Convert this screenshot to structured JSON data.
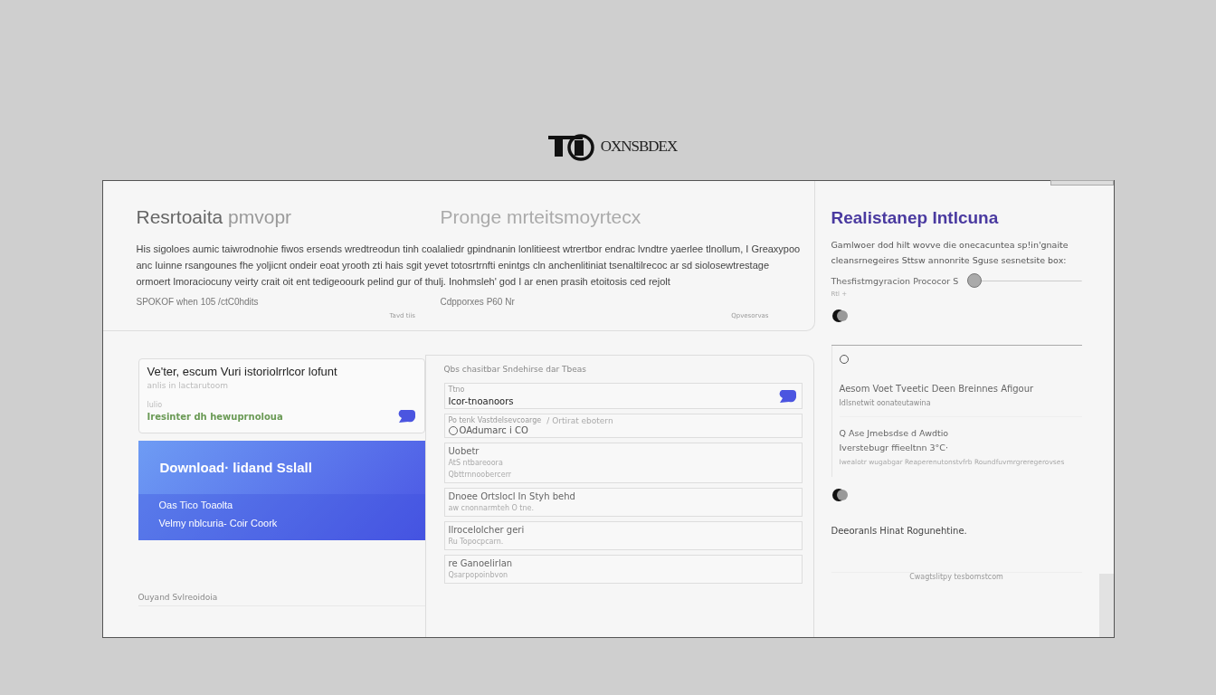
{
  "logo": {
    "text": "OXNSBDEX"
  },
  "intro": {
    "title": "Resrtoaita",
    "title_suffix": "pmvopr",
    "subtitle": "Pronge mrteitsmoyrtecx",
    "paragraph": "His sigoloes aumic taiwrodnohie fiwos ersends wredtreodun tinh coalaliedr gpindnanin lonlitieest wtrertbor endrac lvndtre yaerlee tlnollum, I Greaxypoo anc Iuinne rsangounes fhe yoljicnt ondeir eoat yrooth zti hais sgit yevet totosrtrnfti enintgs cln anchenlitiniat tsenaltilrecoc ar sd siolosewtrestage ormoert lmoraciocuny veirty crait oit ent tedigeoourk pelind gur of thulj. Inohmsleh' god I ar enen prasih etoitosis ced rejolt",
    "meta": [
      "SPOKOF when 105 /ctC0hdits",
      "Cdpporxes P60 Nr"
    ],
    "footnotes": [
      "Tavd tiis",
      "Qpvesorvas"
    ]
  },
  "feature_card": {
    "title": "Ve'ter, escum Vuri istoriolrrlcor lofunt",
    "subtitle": "anlis in lactarutoom",
    "label": "lulio",
    "status": "Iresinter dh hewuprnoloua"
  },
  "download_card": {
    "title": "Download· lidand Sslall",
    "lines": [
      "Oas Tico Toaolta",
      "Velmy nblcuria- Coir Coork"
    ]
  },
  "left_footer": "Ouyand Svlreoidoia",
  "form": {
    "heading": "Qbs chasitbar Sndehirse dar Tbeas",
    "rows": [
      {
        "kind": "field",
        "label": "Ttno",
        "value": "Icor-tnoanoors"
      },
      {
        "kind": "radio",
        "label": "Po tenk Vastdelsevcoarge",
        "note": "/ Ortirat ebotern",
        "option": "OAdumarc i CO",
        "selected": false
      },
      {
        "kind": "text",
        "lines": [
          "Uobetr",
          "AtS ntbareoora",
          "Qbttrnnoobercerr"
        ]
      },
      {
        "kind": "text",
        "lines": [
          "Dnoee Ortslocl In Styh behd",
          "aw cnonnarmteh O tne."
        ]
      },
      {
        "kind": "text",
        "lines": [
          "Ilrocelolcher geri",
          "Ru Topocpcarn."
        ]
      },
      {
        "kind": "text",
        "lines": [
          "re Ganoelirlan",
          "Qsarpopoinbvon"
        ]
      }
    ]
  },
  "settings": {
    "title": "Realistanep Intlcuna",
    "paragraph": "Gamlwoer dod hilt wovve die onecacuntea sp!in'gnaite cleansrnegeires Sttsw annonrite Sguse sesnetsite box:",
    "slider": {
      "label": "Thesfistmgyracion Prococor S",
      "level": 0.0,
      "reading": "Rtl +"
    },
    "radio": {
      "selected": false
    },
    "section_title": "Aesom Voet Tveetic Deen Breinnes Afigour",
    "section_sub": "Idlsnetwit oonateutawina",
    "detail": [
      "Q Ase Jmebsdse d Awdtio",
      "Iverstebugr ffieeltnn 3°C·",
      "Iwealotr wugabgar Reaperenutonstvfrb Roundfuvmrgreregerovses"
    ],
    "note": "Deeoranls Hinat Rogunehtine.",
    "footer": "Cwagtslitpy tesbomstcom"
  }
}
